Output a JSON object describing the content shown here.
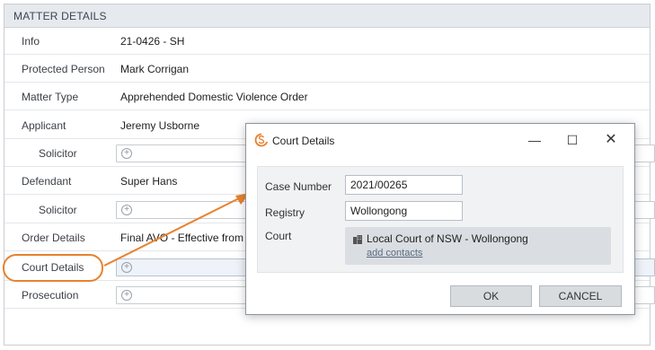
{
  "panel": {
    "title": "MATTER DETAILS"
  },
  "rows": [
    {
      "label": "Info",
      "value": "21-0426 - SH"
    },
    {
      "label": "Protected Person",
      "value": "Mark Corrigan"
    },
    {
      "label": "Matter Type",
      "value": "Apprehended Domestic Violence Order"
    },
    {
      "label": "Applicant",
      "value": "Jeremy Usborne"
    },
    {
      "label": "Solicitor",
      "value": ""
    },
    {
      "label": "Defendant",
      "value": "Super Hans"
    },
    {
      "label": "Solicitor",
      "value": ""
    },
    {
      "label": "Order Details",
      "value": "Final AVO - Effective from"
    },
    {
      "label": "Court Details",
      "value": ""
    },
    {
      "label": "Prosecution",
      "value": ""
    }
  ],
  "add_icon": "plus-circle-icon",
  "dialog": {
    "title": "Court Details",
    "logo_icon": "app-logo-icon",
    "fields": {
      "case_number_label": "Case Number",
      "case_number_value": "2021/00265",
      "registry_label": "Registry",
      "registry_value": "Wollongong",
      "court_label": "Court",
      "court_name": "Local Court of NSW - Wollongong",
      "court_icon": "building-icon",
      "add_contacts_label": "add contacts"
    },
    "buttons": {
      "ok": "OK",
      "cancel": "CANCEL"
    }
  },
  "colors": {
    "accent_orange": "#e8822e",
    "header_bg": "#e6eaef",
    "button_bg": "#d9dcdf",
    "dialog_body_bg": "#f0f2f4"
  }
}
